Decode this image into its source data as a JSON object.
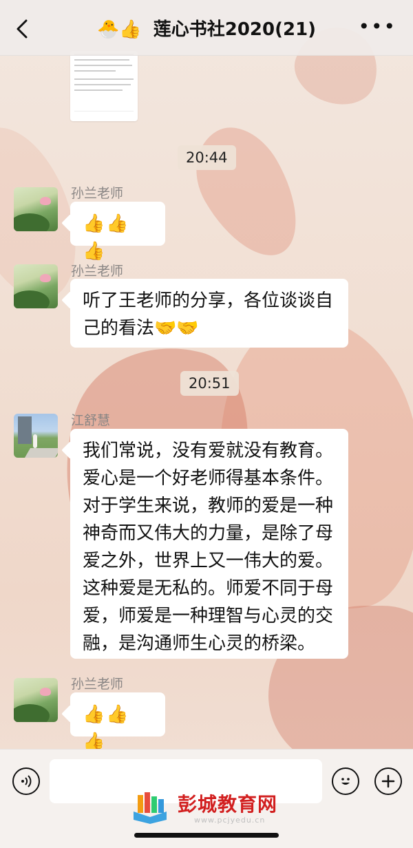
{
  "header": {
    "title_emoji": "🐣👍",
    "title": "莲心书社2020(21)",
    "more": "•••"
  },
  "timestamps": [
    "20:44",
    "20:51"
  ],
  "messages": [
    {
      "sender": "孙兰老师",
      "text": "👍👍👍",
      "avatar": "lotus-avatar"
    },
    {
      "sender": "孙兰老师",
      "text": "听了王老师的分享，各位谈谈自己的看法🤝🤝",
      "avatar": "lotus-avatar"
    },
    {
      "sender": "江舒慧",
      "text": "我们常说，没有爱就没有教育。爱心是一个好老师得基本条件。对于学生来说，教师的爱是一种神奇而又伟大的力量，是除了母爱之外，世界上又一伟大的爱。这种爱是无私的。师爱不同于母爱，师爱是一种理智与心灵的交融，是沟通师生心灵的桥梁。",
      "avatar": "photo-avatar"
    },
    {
      "sender": "孙兰老师",
      "text": "👍👍👍",
      "avatar": "lotus-avatar"
    }
  ],
  "input": {
    "placeholder": ""
  },
  "watermark": {
    "name": "彭城教育网",
    "url": "www.pcjyedu.cn"
  }
}
